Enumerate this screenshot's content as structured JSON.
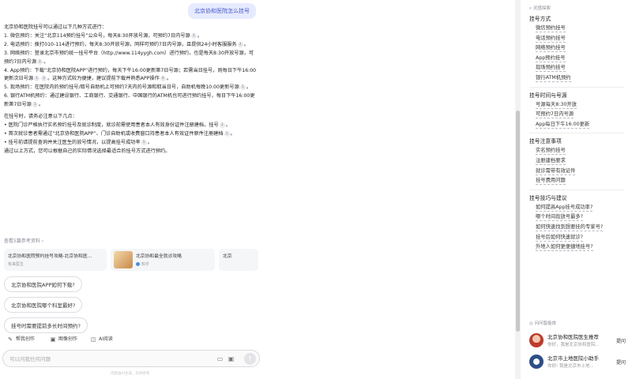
{
  "question": "北京协和医院怎么挂号",
  "answer": {
    "intro": "北京协和医院挂号可以通过以下几种方式进行：",
    "methods": [
      {
        "text": "1. 微信预约：关注“北京114预约挂号”公众号，每天8:30开放号源，可预约7日内号源",
        "cites": [
          "1"
        ]
      },
      {
        "text": "2. 电话预约：拨打010-114进行预约，每天8:30开放号源，同样可预约7日内号源，且提供24小时客服服务",
        "cites": [
          "3"
        ]
      },
      {
        "text": "3. 网络预约：登录北京市预约统一挂号平台（http://www.114yygh.com）进行预约，也是每天8:30开放号源，可预约7日内号源",
        "cites": [
          "1"
        ]
      },
      {
        "text": "4. App预约：下载“北京协和医院APP”进行预约，每天下午16:00更新第7日号源；若需当日挂号，则每日下午16:00更新次日号源",
        "cites": [
          "1",
          "2"
        ],
        "tail": "。这种方式较为便捷，建议提前下载并熟悉APP操作",
        "tail_cites": [
          "4"
        ]
      },
      {
        "text": "5. 现场预约：在医院内的预约挂号/取号自助机上可预约7天内的号源和取当日号，自助机每晚10:00更新号源",
        "cites": [
          "1"
        ]
      },
      {
        "text": "6. 银行ATM机预约：通过建设银行、工商银行、交通银行、中国银行的ATM机也可进行预约挂号，每日下午16:00更新第7日号源",
        "cites": [
          "1"
        ]
      }
    ],
    "notes_title": "在挂号时，请务必注意以下几点：",
    "notes": [
      {
        "text": "• 医院门诊严格执行实名预约挂号及就诊制度，就诊前需使用患者本人有效身份证件注册建档，挂号",
        "cites": [
          "1"
        ]
      },
      {
        "text": "• 首次就诊患者需通过“北京协和医院APP”、门诊自助机或收费窗口持患者本人有效证件原件注册建档",
        "cites": [
          "1"
        ]
      },
      {
        "text": "• 挂号前请提前查询并关注医生的放号情况，以提高挂号成功率",
        "cites": [
          "5"
        ]
      }
    ],
    "conclusion": "通过以上方式，您可以根据自己的实际情况选择最适合的挂号方式进行预约。"
  },
  "references": {
    "link": "查看5篇参考资料 ›",
    "cards": [
      {
        "title": "北京协和医院预约挂号攻略-北京协和医...",
        "source": "有来医生"
      },
      {
        "title": "北京协和最全就诊攻略",
        "source": "知乎"
      },
      {
        "title": "北京",
        "source": ""
      }
    ]
  },
  "suggestions": [
    "北京协和医院APP如何下载?",
    "北京协和医院哪个科室最好?",
    "挂号时需要提前多长时间预约?"
  ],
  "tools": [
    {
      "icon": "✎",
      "label": "帮我创作"
    },
    {
      "icon": "▣",
      "label": "图像创作"
    },
    {
      "icon": "◫",
      "label": "AI阅读"
    }
  ],
  "input": {
    "placeholder": "可以问我任何问题"
  },
  "footer_note": "内容由AI生成，仅供参考",
  "sidebar": {
    "header": "灵感探索",
    "sections": [
      {
        "title": "挂号方式",
        "items": [
          "微信预约挂号",
          "电话预约挂号",
          "网络预约挂号",
          "App预约挂号",
          "现场预约挂号",
          "银行ATM机预约"
        ]
      },
      {
        "title": "挂号时间与号源",
        "items": [
          "号源每天8:30开放",
          "可预约7日内号源",
          "App每日下午16:00更新"
        ]
      },
      {
        "title": "挂号注意事项",
        "items": [
          "实名预约挂号",
          "注册建档要求",
          "就诊需带有效证件",
          "挂号费用问题"
        ]
      },
      {
        "title": "挂号技巧与建议",
        "items": [
          "如何提高App挂号成功率?",
          "哪个时间段放号最多?",
          "如何快速找到想要挂的专家号?",
          "挂号后如何快速就诊?",
          "外地人如何更便捷地挂号?"
        ]
      }
    ],
    "agents_header": "问问智能体",
    "agents": [
      {
        "name": "北京协和医院医生推荐",
        "desc": "你好，我是北京协和医院...",
        "ask": "提问"
      },
      {
        "name": "北京市上地医院小助手",
        "desc": "你好! 我是北京市上地...",
        "ask": "提问"
      }
    ]
  },
  "colors": {
    "accent": "#4b5bd9",
    "bubble": "#e6ebff",
    "border": "#dcdce2"
  }
}
